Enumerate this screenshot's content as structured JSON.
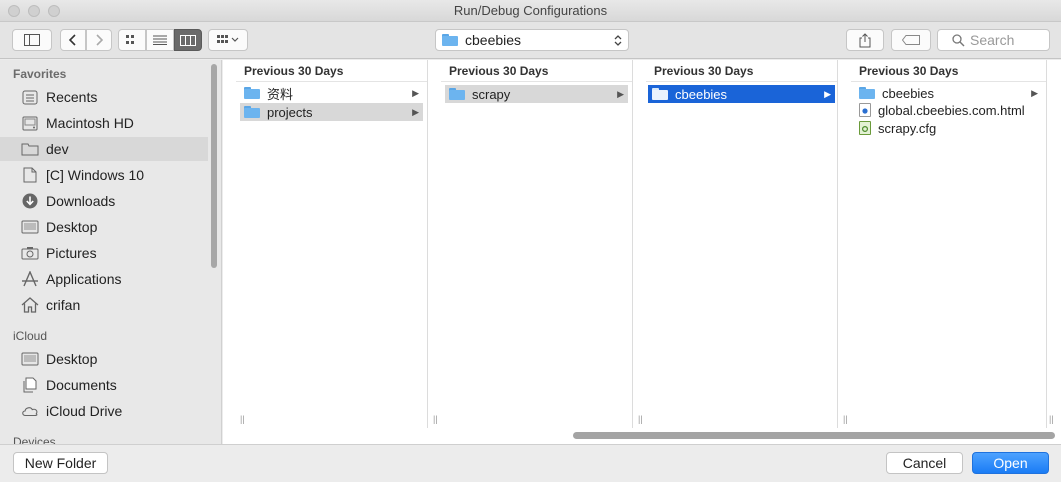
{
  "window": {
    "title": "Run/Debug Configurations"
  },
  "toolbar": {
    "path_popup": "cbeebies",
    "search_placeholder": "Search"
  },
  "sidebar": {
    "favorites_header": "Favorites",
    "favorites": [
      {
        "label": "Recents",
        "icon": "recents-icon"
      },
      {
        "label": "Macintosh HD",
        "icon": "hard-drive-icon"
      },
      {
        "label": "dev",
        "icon": "folder-icon"
      },
      {
        "label": "[C] Windows 10",
        "icon": "document-icon"
      },
      {
        "label": "Downloads",
        "icon": "download-icon"
      },
      {
        "label": "Desktop",
        "icon": "desktop-icon"
      },
      {
        "label": "Pictures",
        "icon": "camera-icon"
      },
      {
        "label": "Applications",
        "icon": "applications-icon"
      },
      {
        "label": "crifan",
        "icon": "home-icon"
      }
    ],
    "icloud_header": "iCloud",
    "icloud": [
      {
        "label": "Desktop",
        "icon": "desktop-icon"
      },
      {
        "label": "Documents",
        "icon": "documents-icon"
      },
      {
        "label": "iCloud Drive",
        "icon": "cloud-icon"
      }
    ],
    "devices_header": "Devices"
  },
  "columns": [
    {
      "header": "Previous 30 Days",
      "items": [
        {
          "label": "资料"
        },
        {
          "label": "projects"
        }
      ]
    },
    {
      "header": "Previous 30 Days",
      "items": [
        {
          "label": "scrapy"
        }
      ]
    },
    {
      "header": "Previous 30 Days",
      "items": [
        {
          "label": "cbeebies"
        }
      ]
    },
    {
      "header": "Previous 30 Days",
      "items": [
        {
          "label": "cbeebies"
        },
        {
          "label": "global.cbeebies.com.html"
        },
        {
          "label": "scrapy.cfg"
        }
      ]
    }
  ],
  "buttons": {
    "new_folder": "New Folder",
    "cancel": "Cancel",
    "open": "Open"
  },
  "colors": {
    "accent": "#1a64d8"
  }
}
